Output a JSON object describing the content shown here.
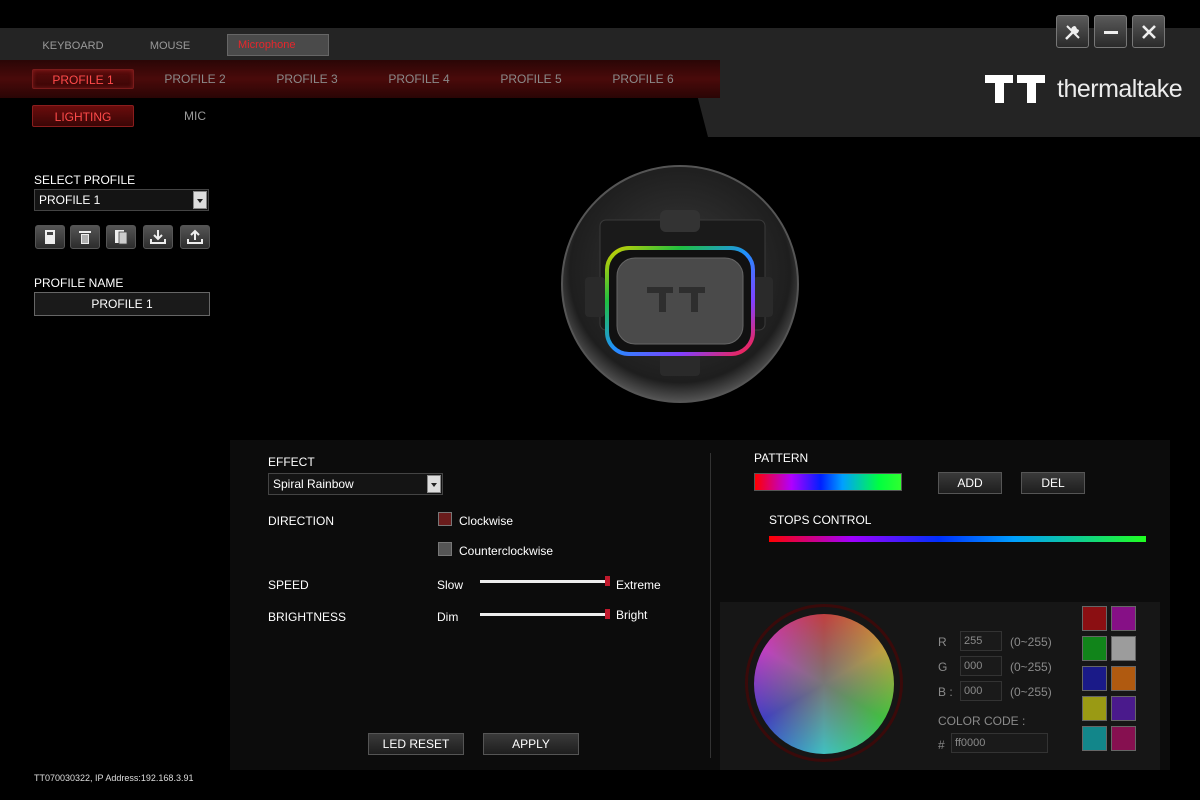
{
  "device_tabs": [
    "KEYBOARD",
    "MOUSE",
    "Microphone"
  ],
  "brand": {
    "name": "thermaltake"
  },
  "profile_tabs": [
    "PROFILE 1",
    "PROFILE 2",
    "PROFILE 3",
    "PROFILE 4",
    "PROFILE 5",
    "PROFILE 6"
  ],
  "sub_tabs": [
    "LIGHTING",
    "MIC"
  ],
  "left": {
    "select_profile_label": "SELECT PROFILE",
    "select_profile_value": "PROFILE 1",
    "profile_name_label": "PROFILE NAME",
    "profile_name_value": "PROFILE 1",
    "icon_buttons": [
      "save-icon",
      "delete-icon",
      "copy-icon",
      "import-icon",
      "export-icon"
    ]
  },
  "effect": {
    "label": "EFFECT",
    "value": "Spiral Rainbow",
    "direction_label": "DIRECTION",
    "directions": [
      "Clockwise",
      "Counterclockwise"
    ],
    "direction_selected": "Clockwise",
    "speed_label": "SPEED",
    "speed_min": "Slow",
    "speed_max": "Extreme",
    "speed_level": 1.0,
    "brightness_label": "BRIGHTNESS",
    "brightness_min": "Dim",
    "brightness_max": "Bright",
    "brightness_level": 1.0,
    "led_reset": "LED RESET",
    "apply": "APPLY"
  },
  "pattern": {
    "label": "PATTERN",
    "add": "ADD",
    "del": "DEL",
    "stops_label": "STOPS CONTROL"
  },
  "color": {
    "r_label": "R",
    "g_label": "G",
    "b_label": "B :",
    "r": "255",
    "g": "000",
    "b": "000",
    "range": "(0~255)",
    "code_label": "COLOR CODE :",
    "hash": "#",
    "code": "ff0000",
    "swatches": [
      "#8b0f12",
      "#861086",
      "#11841a",
      "#9c9c9c",
      "#1a1a88",
      "#b05a10",
      "#9a9a14",
      "#4a1a8c",
      "#12868a",
      "#861050"
    ]
  },
  "status": "TT070030322, IP Address:192.168.3.91",
  "colors": {
    "accent": "#c0192c",
    "active_text": "#ff4a4a"
  }
}
